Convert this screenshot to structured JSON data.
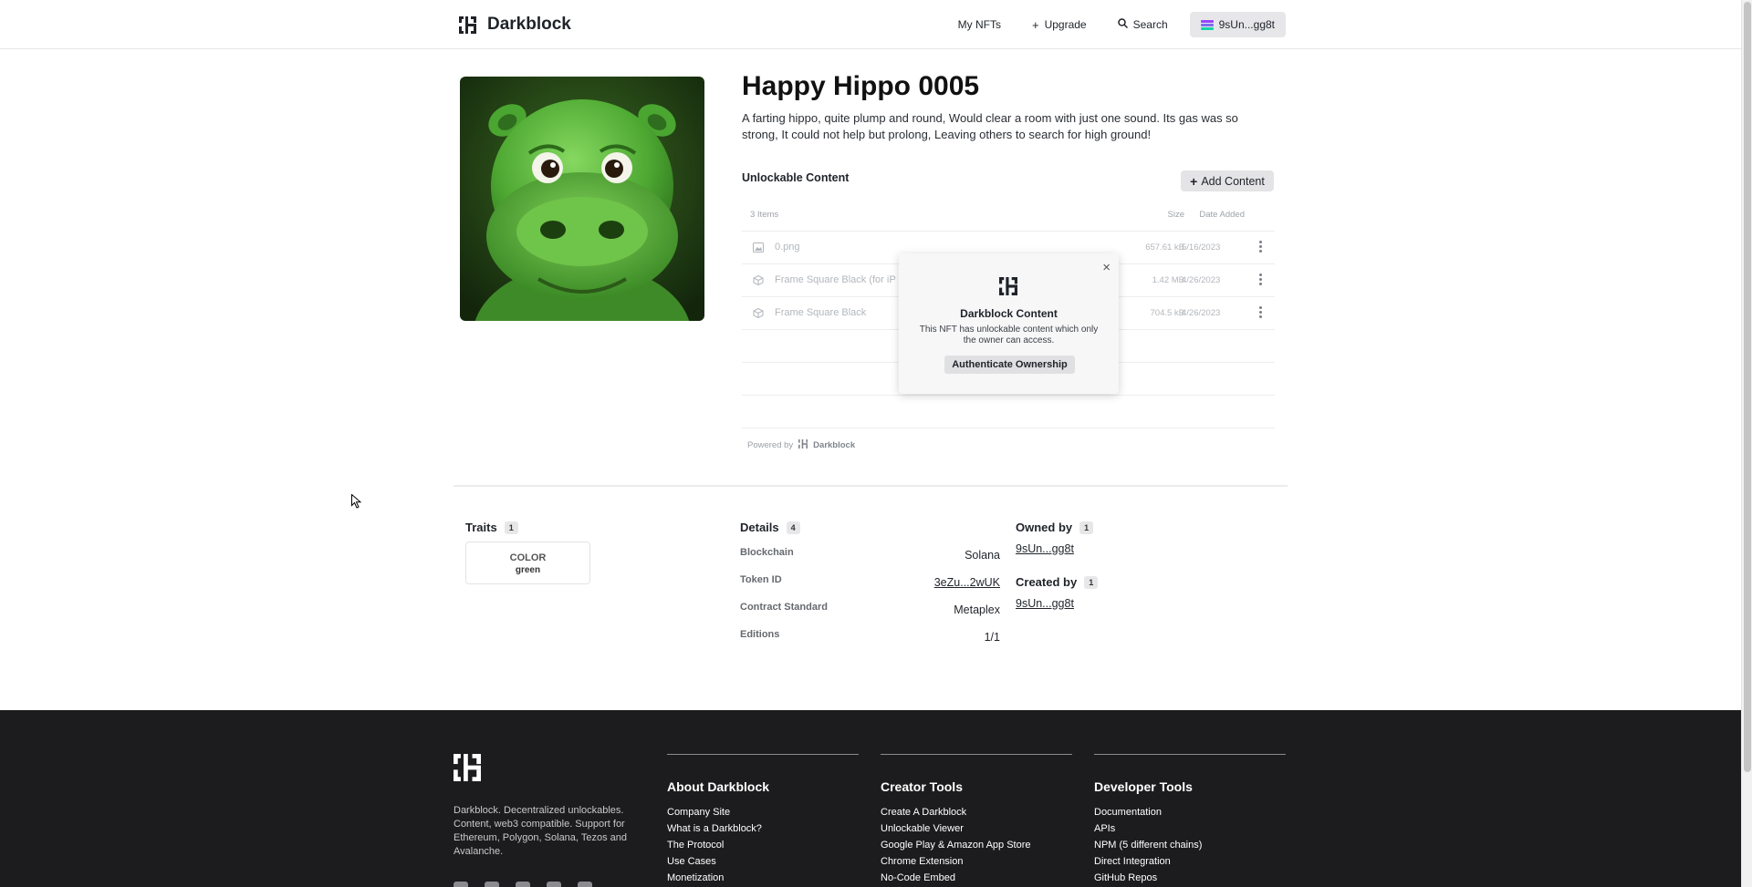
{
  "header": {
    "brand": "Darkblock",
    "nav": {
      "my_nfts": "My NFTs",
      "upgrade": "Upgrade",
      "search": "Search",
      "wallet": "9sUn...gg8t"
    }
  },
  "nft": {
    "title": "Happy Hippo 0005",
    "description": "A farting hippo, quite plump and round, Would clear a room with just one sound. Its gas was so strong, It could not help but prolong, Leaving others to search for high ground!"
  },
  "unlockable": {
    "title": "Unlockable Content",
    "add_label": "Add Content",
    "columns": {
      "items": "3 Items",
      "size": "Size",
      "date": "Date Added"
    },
    "rows": [
      {
        "icon": "image-icon",
        "name": "0.png",
        "size": "657.61 kB",
        "date": "5/16/2023"
      },
      {
        "icon": "cube-icon",
        "name": "Frame Square Black (for iP",
        "size": "1.42 MB",
        "date": "4/26/2023"
      },
      {
        "icon": "cube-icon",
        "name": "Frame Square Black",
        "size": "704.5 kB",
        "date": "4/26/2023"
      }
    ],
    "powered_by": "Powered by",
    "powered_brand": "Darkblock"
  },
  "popup": {
    "title": "Darkblock Content",
    "text": "This NFT has unlockable content which only the owner can access.",
    "button": "Authenticate Ownership",
    "close": "×"
  },
  "traits": {
    "title": "Traits",
    "count": "1",
    "items": [
      {
        "type": "COLOR",
        "value": "green"
      }
    ]
  },
  "details": {
    "title": "Details",
    "count": "4",
    "rows": [
      {
        "label": "Blockchain",
        "value": "Solana"
      },
      {
        "label": "Token ID",
        "value": "3eZu...2wUK"
      },
      {
        "label": "Contract Standard",
        "value": "Metaplex"
      },
      {
        "label": "Editions",
        "value": "1/1"
      }
    ]
  },
  "owned": {
    "title": "Owned by",
    "count": "1",
    "value": "9sUn...gg8t"
  },
  "created": {
    "title": "Created by",
    "count": "1",
    "value": "9sUn...gg8t"
  },
  "footer": {
    "about": "Darkblock. Decentralized unlockables. Content, web3 compatible. Support for Ethereum, Polygon, Solana, Tezos and Avalanche.",
    "columns": [
      {
        "title": "About Darkblock",
        "links": [
          "Company Site",
          "What is a Darkblock?",
          "The Protocol",
          "Use Cases",
          "Monetization"
        ]
      },
      {
        "title": "Creator Tools",
        "links": [
          "Create A Darkblock",
          "Unlockable Viewer",
          "Google Play  &  Amazon App Store",
          "Chrome Extension",
          "No-Code Embed"
        ]
      },
      {
        "title": "Developer Tools",
        "links": [
          "Documentation",
          "APIs",
          "NPM (5 different chains)",
          "Direct Integration",
          "GitHub Repos"
        ]
      }
    ]
  },
  "colors": {
    "accent": "#1f2329",
    "footer_bg": "#1c1c1e",
    "hippo_green": "#4caf3a"
  }
}
